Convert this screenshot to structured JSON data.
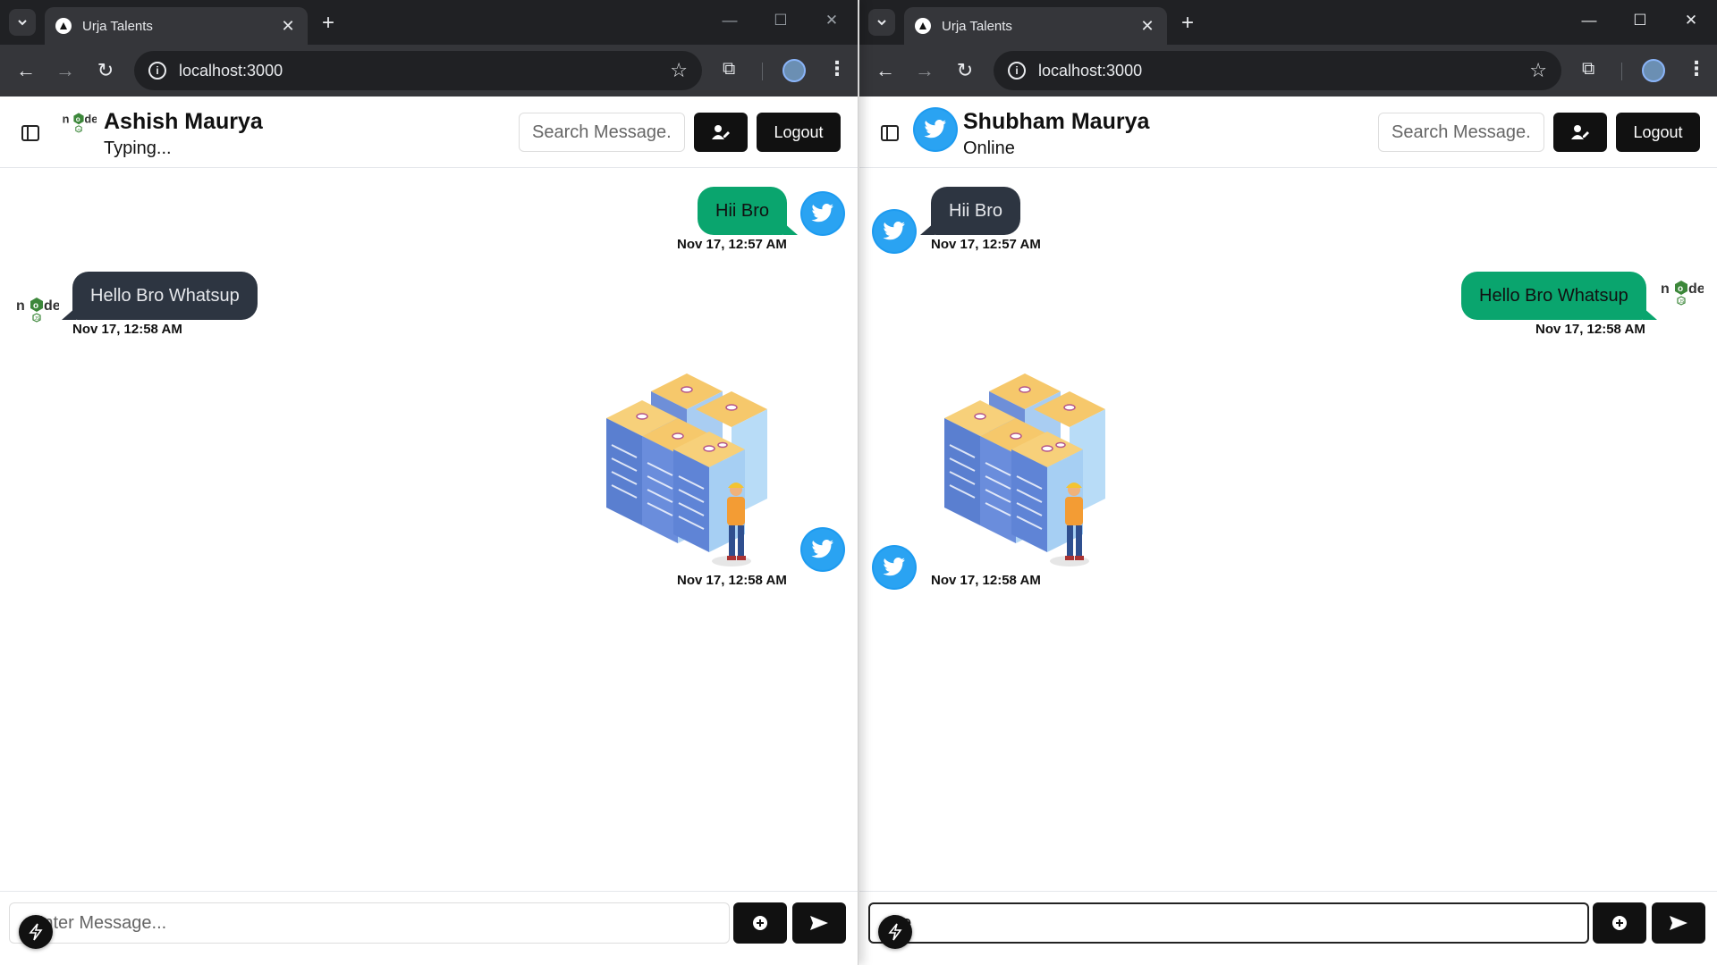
{
  "browser": {
    "tab_title": "Urja Talents",
    "url": "localhost:3000",
    "new_tab_label": "+",
    "close_tab_label": "✕"
  },
  "left_window": {
    "peer": {
      "name": "Ashish Maurya",
      "status": "Typing...",
      "avatar_icon": "nodejs-logo-icon"
    },
    "search_placeholder": "Search Message.",
    "logout_label": "Logout",
    "composer": {
      "placeholder": "Enter Message...",
      "value": ""
    },
    "messages": [
      {
        "direction": "sent",
        "text": "Hii Bro",
        "time": "Nov 17, 12:57 AM",
        "avatar_icon": "twitter-bird-icon"
      },
      {
        "direction": "received",
        "text": "Hello Bro Whatsup",
        "time": "Nov 17, 12:58 AM",
        "avatar_icon": "nodejs-logo-icon"
      },
      {
        "direction": "sent",
        "type": "image",
        "image": "server-room-illustration",
        "time": "Nov 17, 12:58 AM",
        "avatar_icon": "twitter-bird-icon"
      }
    ]
  },
  "right_window": {
    "peer": {
      "name": "Shubham Maurya",
      "status": "Online",
      "avatar_icon": "twitter-bird-icon"
    },
    "search_placeholder": "Search Message.",
    "logout_label": "Logout",
    "composer": {
      "placeholder": "",
      "value": "he"
    },
    "messages": [
      {
        "direction": "received",
        "text": "Hii Bro",
        "time": "Nov 17, 12:57 AM",
        "avatar_icon": "twitter-bird-icon"
      },
      {
        "direction": "sent",
        "text": "Hello Bro Whatsup",
        "time": "Nov 17, 12:58 AM",
        "avatar_icon": "nodejs-logo-icon"
      },
      {
        "direction": "received",
        "type": "image",
        "image": "server-room-illustration",
        "time": "Nov 17, 12:58 AM",
        "avatar_icon": "twitter-bird-icon"
      }
    ]
  },
  "colors": {
    "sent_bubble": "#0aa56e",
    "received_bubble": "#2d3541",
    "twitter_blue": "#1da1f2",
    "node_green": "#3c873a"
  }
}
